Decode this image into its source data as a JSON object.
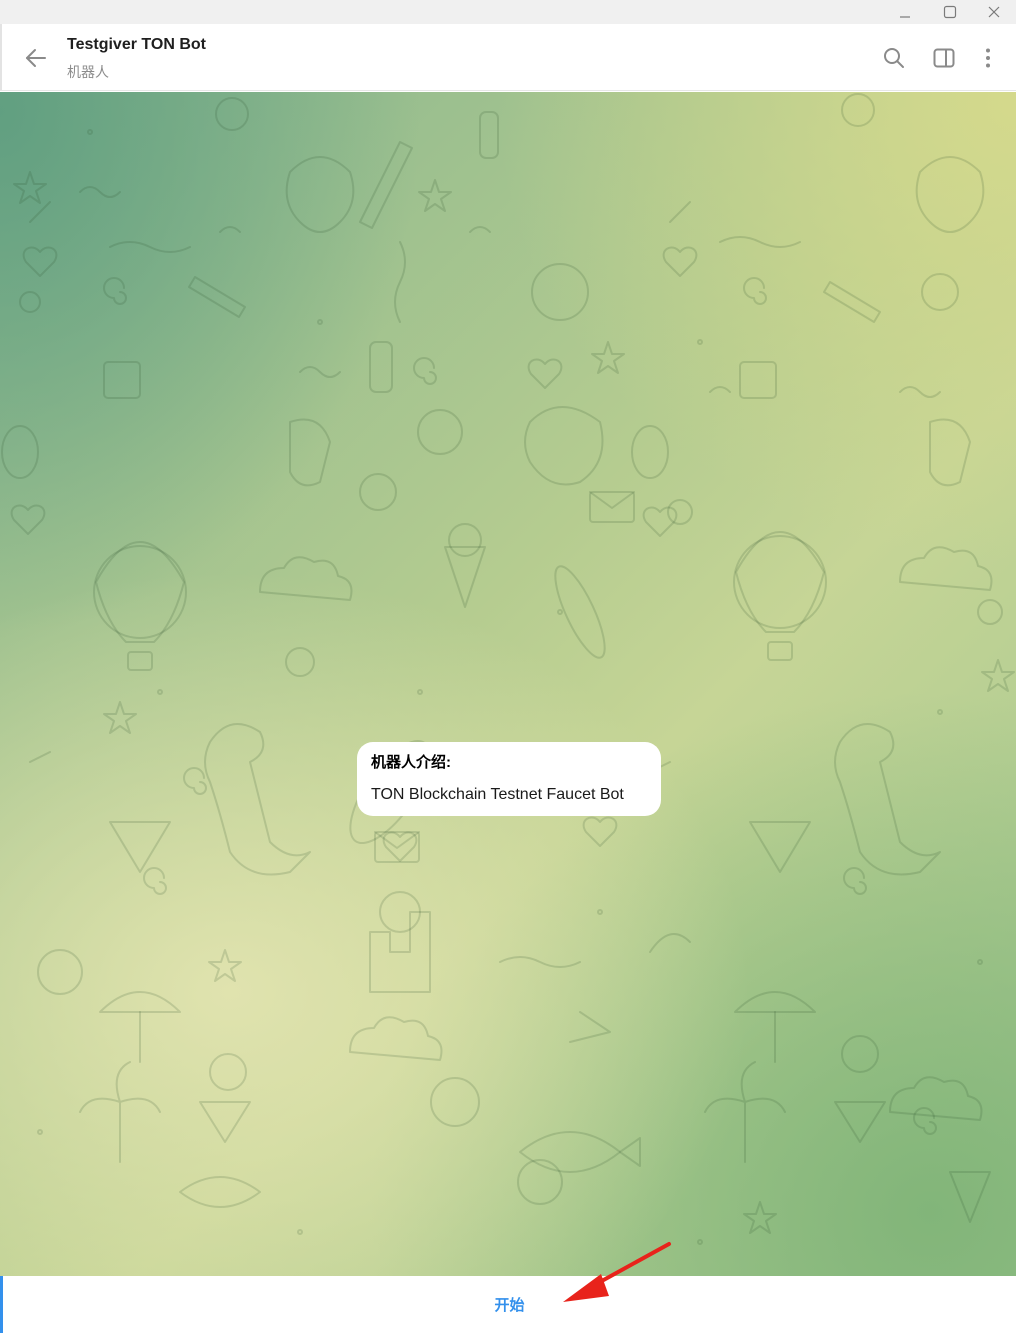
{
  "window": {
    "controls": {
      "minimize_icon": "minimize-icon",
      "maximize_icon": "maximize-icon",
      "close_icon": "close-icon"
    }
  },
  "header": {
    "back_icon": "arrow-left-icon",
    "title": "Testgiver TON Bot",
    "subtitle": "机器人",
    "actions": [
      "search-icon",
      "side-panel-icon",
      "more-vertical-icon"
    ]
  },
  "chat": {
    "background": "doodle-pattern-green-yellow-gradient",
    "intro_bubble": {
      "title": "机器人介绍:",
      "text": "TON Blockchain Testnet Faucet Bot"
    }
  },
  "footer": {
    "start_label": "开始"
  },
  "annotation": {
    "arrow_icon": "red-arrow-icon",
    "color": "#e8231b"
  },
  "colors": {
    "accent": "#3390ec",
    "bubble": "#ffffff",
    "titlebar": "#f0f0f0"
  }
}
